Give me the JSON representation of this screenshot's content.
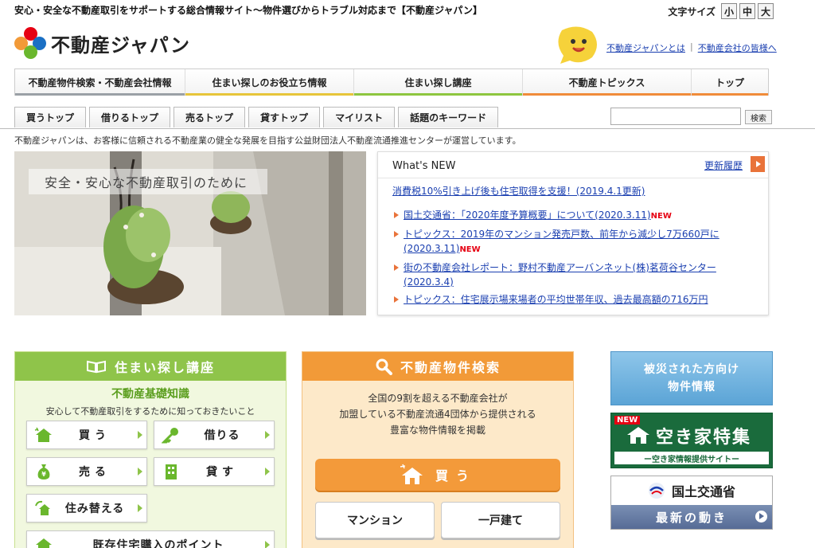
{
  "header": {
    "tagline": "安心・安全な不動産取引をサポートする総合情報サイト～物件選びからトラブル対応まで【不動産ジャパン】",
    "font_size_label": "文字サイズ",
    "font_sizes": [
      "小",
      "中",
      "大"
    ],
    "logo_text": "不動産ジャパン",
    "links": [
      "不動産ジャパンとは",
      "不動産会社の皆様へ"
    ]
  },
  "main_nav": [
    "不動産物件検索・不動産会社情報",
    "住まい探しのお役立ち情報",
    "住まい探し講座",
    "不動産トピックス",
    "トップ"
  ],
  "sub_nav": [
    "買うトップ",
    "借りるトップ",
    "売るトップ",
    "貸すトップ",
    "マイリスト",
    "話題のキーワード"
  ],
  "search": {
    "button": "検索",
    "placeholder": ""
  },
  "notice": "不動産ジャパンは、お客様に信頼される不動産業の健全な発展を目指す公益財団法人不動産流通推進センターが運営しています。",
  "hero": {
    "caption": "安全・安心な不動産取引のために"
  },
  "news": {
    "heading": "What's NEW",
    "history_link": "更新履歴",
    "headline": "消費税10%引き上げ後も住宅取得を支援！(2019.4.1更新)",
    "new_badge": "NEW",
    "items": [
      {
        "text": "国土交通省：「2020年度予算概要」について(2020.3.11)",
        "is_new": true
      },
      {
        "text": "トピックス：2019年のマンション発売戸数、前年から減少し7万660戸に(2020.3.11)",
        "is_new": true
      },
      {
        "text": "街の不動産会社レポート：野村不動産アーバンネット(株)茗荷谷センター(2020.3.4)",
        "is_new": false
      },
      {
        "text": "トピックス：住宅展示場来場者の平均世帯年収、過去最高額の716万円",
        "is_new": false
      }
    ]
  },
  "course": {
    "title": "住まい探し講座",
    "subtitle": "不動産基礎知識",
    "description": "安心して不動産取引をするために知っておきたいこと",
    "buttons": [
      "買う",
      "借りる",
      "売る",
      "貸す",
      "住み替える",
      "既存住宅購入のポイント"
    ]
  },
  "property_search": {
    "title": "不動産物件検索",
    "description_lines": [
      "全国の9割を超える不動産会社が",
      "加盟している不動産流通4団体から提供される",
      "豊富な物件情報を掲載"
    ],
    "buy_label": "買う",
    "types": [
      "マンション",
      "一戸建て"
    ]
  },
  "side": {
    "disaster_lines": [
      "被災された方向け",
      "物件情報"
    ],
    "akiya_new": "NEW",
    "akiya_title": "空き家特集",
    "akiya_sub": "ー空き家情報提供サイトー",
    "mlit_title": "国土交通省",
    "mlit_sub": "最新の動き"
  },
  "colors": {
    "green": "#8fc44a",
    "orange": "#f29a38",
    "link": "#1a3fb0",
    "new": "#e60012"
  }
}
